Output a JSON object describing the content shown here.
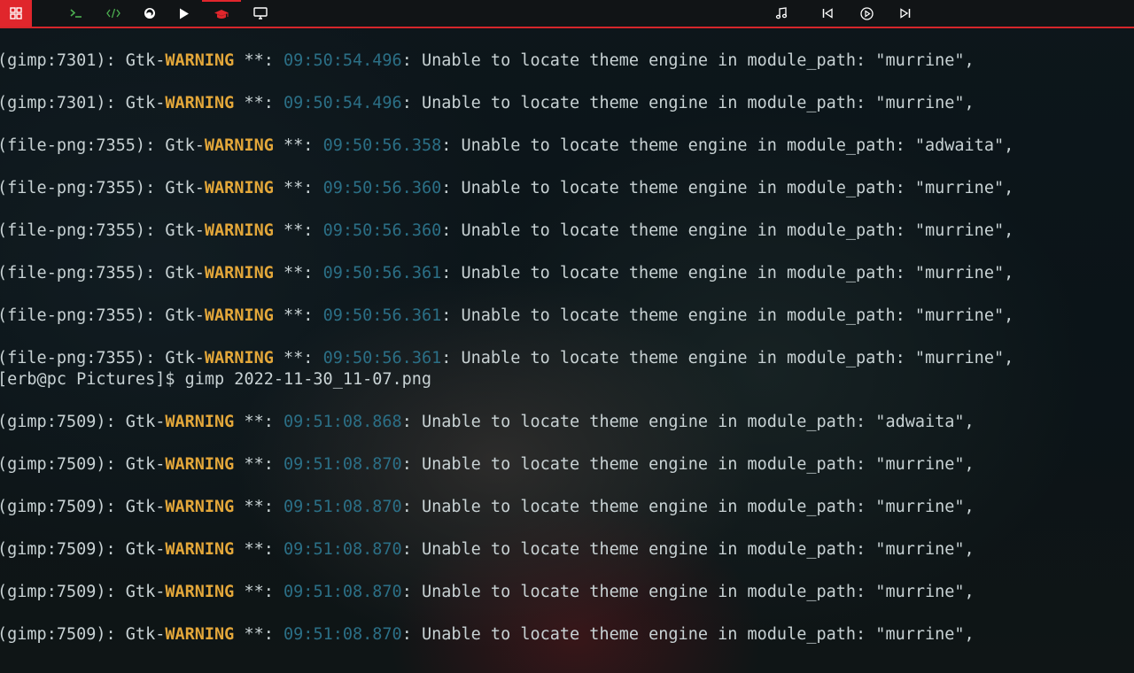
{
  "topbar": {
    "apps_icon": "grid-icon",
    "launchers": [
      {
        "name": "terminal-icon",
        "color": "#4caf50"
      },
      {
        "name": "code-icon",
        "color": "#4caf50"
      },
      {
        "name": "firefox-icon",
        "color": "#ffffff"
      },
      {
        "name": "play-icon",
        "color": "#ffffff"
      },
      {
        "name": "graduation-cap-icon",
        "color": "#e0262c"
      },
      {
        "name": "monitor-icon",
        "color": "#ffffff"
      }
    ],
    "media": [
      "music-note-icon",
      "previous-track-icon",
      "play-circle-icon",
      "next-track-icon"
    ],
    "accent": "#e0262c"
  },
  "terminal": {
    "lines": [
      {
        "kind": "warn",
        "pre": "(gimp:7301): Gtk-",
        "tag": "WARNING",
        "mid": " **: ",
        "ts": "09:50:54.496",
        "msg": ": Unable to locate theme engine in module_path: \"murrine\","
      },
      {
        "kind": "warn",
        "pre": "(gimp:7301): Gtk-",
        "tag": "WARNING",
        "mid": " **: ",
        "ts": "09:50:54.496",
        "msg": ": Unable to locate theme engine in module_path: \"murrine\","
      },
      {
        "kind": "warn",
        "pre": "(file-png:7355): Gtk-",
        "tag": "WARNING",
        "mid": " **: ",
        "ts": "09:50:56.358",
        "msg": ": Unable to locate theme engine in module_path: \"adwaita\","
      },
      {
        "kind": "warn",
        "pre": "(file-png:7355): Gtk-",
        "tag": "WARNING",
        "mid": " **: ",
        "ts": "09:50:56.360",
        "msg": ": Unable to locate theme engine in module_path: \"murrine\","
      },
      {
        "kind": "warn",
        "pre": "(file-png:7355): Gtk-",
        "tag": "WARNING",
        "mid": " **: ",
        "ts": "09:50:56.360",
        "msg": ": Unable to locate theme engine in module_path: \"murrine\","
      },
      {
        "kind": "warn",
        "pre": "(file-png:7355): Gtk-",
        "tag": "WARNING",
        "mid": " **: ",
        "ts": "09:50:56.361",
        "msg": ": Unable to locate theme engine in module_path: \"murrine\","
      },
      {
        "kind": "warn",
        "pre": "(file-png:7355): Gtk-",
        "tag": "WARNING",
        "mid": " **: ",
        "ts": "09:50:56.361",
        "msg": ": Unable to locate theme engine in module_path: \"murrine\","
      },
      {
        "kind": "warn",
        "pre": "(file-png:7355): Gtk-",
        "tag": "WARNING",
        "mid": " **: ",
        "ts": "09:50:56.361",
        "msg": ": Unable to locate theme engine in module_path: \"murrine\","
      },
      {
        "kind": "prompt",
        "text": "[erb@pc Pictures]$ gimp 2022-11-30_11-07.png"
      },
      {
        "kind": "warn",
        "pre": "(gimp:7509): Gtk-",
        "tag": "WARNING",
        "mid": " **: ",
        "ts": "09:51:08.868",
        "msg": ": Unable to locate theme engine in module_path: \"adwaita\","
      },
      {
        "kind": "warn",
        "pre": "(gimp:7509): Gtk-",
        "tag": "WARNING",
        "mid": " **: ",
        "ts": "09:51:08.870",
        "msg": ": Unable to locate theme engine in module_path: \"murrine\","
      },
      {
        "kind": "warn",
        "pre": "(gimp:7509): Gtk-",
        "tag": "WARNING",
        "mid": " **: ",
        "ts": "09:51:08.870",
        "msg": ": Unable to locate theme engine in module_path: \"murrine\","
      },
      {
        "kind": "warn",
        "pre": "(gimp:7509): Gtk-",
        "tag": "WARNING",
        "mid": " **: ",
        "ts": "09:51:08.870",
        "msg": ": Unable to locate theme engine in module_path: \"murrine\","
      },
      {
        "kind": "warn",
        "pre": "(gimp:7509): Gtk-",
        "tag": "WARNING",
        "mid": " **: ",
        "ts": "09:51:08.870",
        "msg": ": Unable to locate theme engine in module_path: \"murrine\","
      },
      {
        "kind": "warn",
        "pre": "(gimp:7509): Gtk-",
        "tag": "WARNING",
        "mid": " **: ",
        "ts": "09:51:08.870",
        "msg": ": Unable to locate theme engine in module_path: \"murrine\","
      }
    ],
    "colors": {
      "warning": "#e3a73a",
      "timestamp": "#2b6f86",
      "text": "#c8d2d4"
    }
  }
}
